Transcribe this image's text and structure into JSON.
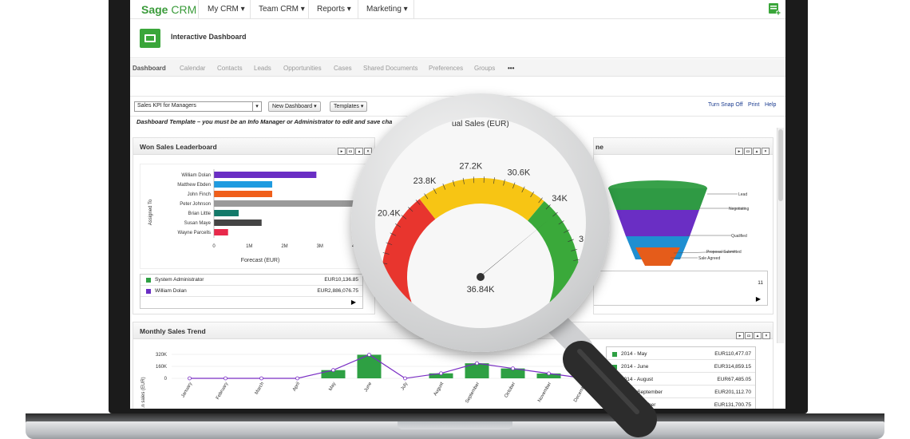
{
  "app": {
    "logo_brand": "Sage",
    "logo_product": "CRM"
  },
  "topnav": {
    "items": [
      "My CRM",
      "Team CRM",
      "Reports",
      "Marketing"
    ]
  },
  "header": {
    "title": "Interactive Dashboard"
  },
  "tabs": [
    "Dashboard",
    "Calendar",
    "Contacts",
    "Leads",
    "Opportunities",
    "Cases",
    "Shared Documents",
    "Preferences",
    "Groups",
    "•••"
  ],
  "toolbar": {
    "selected_dashboard": "Sales KPI for Managers",
    "new_dashboard_label": "New Dashboard",
    "templates_label": "Templates",
    "links": [
      "Turn Snap Off",
      "Print",
      "Help"
    ]
  },
  "notice": "Dashboard Template – you must be an Info Manager or Administrator to edit and save cha",
  "leaderboard": {
    "title": "Won Sales Leaderboard",
    "legend": [
      {
        "name": "System Administrator",
        "value": "EUR10,136.85",
        "color": "#2ea043"
      },
      {
        "name": "William Dolan",
        "value": "EUR2,886,076.75",
        "color": "#6a2ec4"
      }
    ]
  },
  "gauge_panel": {
    "title_fragment": "ual Sales (EUR)",
    "value_label": "36.84K",
    "value": 36.84,
    "ticks": [
      "…K",
      "20.4K",
      "23.8K",
      "27.2K",
      "30.6K",
      "34K",
      "3…"
    ]
  },
  "funnel_panel": {
    "title_fragment": "ne",
    "count": "11",
    "stages": [
      "Lead",
      "Negotiating",
      "Qualified",
      "Proposal Submitted",
      "Sale Agreed"
    ]
  },
  "trend": {
    "title": "Monthly Sales Trend",
    "ylabel": "…n sales (EUR)",
    "legend": [
      {
        "name": "2014 - May",
        "value": "EUR110,477.07",
        "color": "#2ea043"
      },
      {
        "name": "2014 - June",
        "value": "EUR314,859.15",
        "color": "#2ea043"
      },
      {
        "name": "2014 - August",
        "value": "EUR67,485.05",
        "color": "#2ea043"
      },
      {
        "name": "2014 - September",
        "value": "EUR201,112.70",
        "color": "#2ea043"
      },
      {
        "name": "2014 - October",
        "value": "EUR131,700.75",
        "color": "#2ea043"
      }
    ]
  },
  "chart_data": [
    {
      "type": "bar",
      "orientation": "horizontal",
      "title": "Won Sales Leaderboard",
      "ylabel": "Assigned To",
      "xlabel": "Forecast (EUR)",
      "xticks": [
        "0",
        "1M",
        "2M",
        "3M",
        "4M"
      ],
      "xlim": [
        0,
        4.7
      ],
      "categories": [
        "William Dolan",
        "Matthew Ebden",
        "John Finch",
        "Peter Johnson",
        "Brian Little",
        "Susan Maye",
        "Wayne Parcells"
      ],
      "values": [
        2.9,
        1.65,
        1.65,
        4.7,
        0.7,
        1.35,
        0.4
      ],
      "colors": [
        "#6a2ec4",
        "#1f9be0",
        "#f05f1a",
        "#9a9a9a",
        "#137a6a",
        "#444444",
        "#e8294b"
      ]
    },
    {
      "type": "bar",
      "title": "Monthly Sales Trend",
      "ylabel": "…n sales (EUR)",
      "yticks": [
        "320K",
        "160K",
        "0"
      ],
      "ylim": [
        0,
        320
      ],
      "categories": [
        "January",
        "February",
        "March",
        "April",
        "May",
        "June",
        "July",
        "August",
        "September",
        "October",
        "November",
        "December"
      ],
      "values": [
        0,
        0,
        0,
        0,
        110,
        315,
        0,
        67,
        201,
        132,
        65,
        0
      ],
      "line": [
        0,
        0,
        0,
        0,
        110,
        315,
        0,
        67,
        201,
        132,
        65,
        0
      ],
      "bar_color": "#2ea043",
      "line_color": "#7a2ec4"
    }
  ]
}
